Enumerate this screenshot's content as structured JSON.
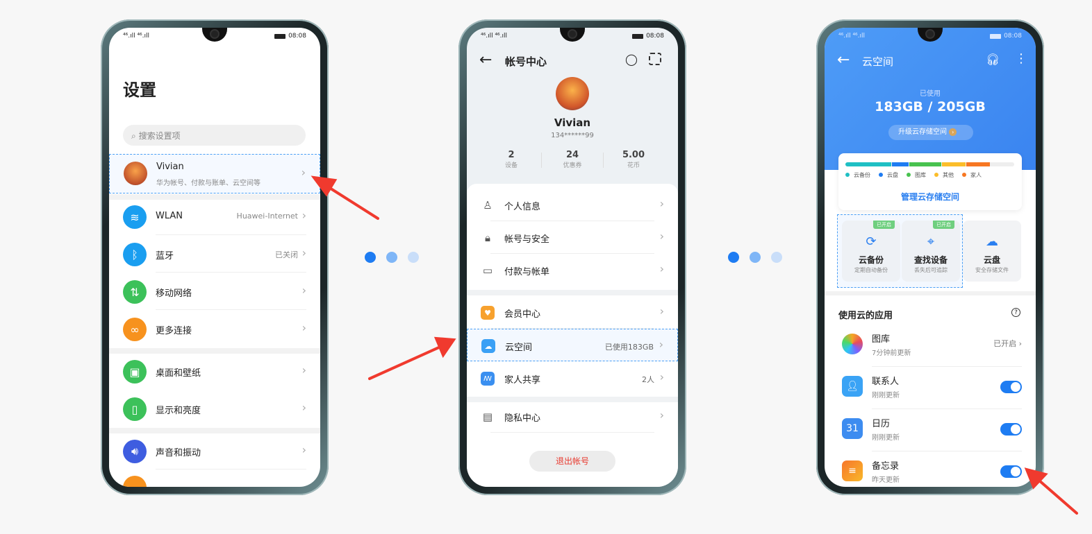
{
  "status": {
    "time": "08:08",
    "signal": "⁴⁶.ıll ⁴⁶.ıll"
  },
  "colors": {
    "accent": "#1e7cf2",
    "arrow": "#f03a2e",
    "highlight": "#4a9ff5"
  },
  "settings": {
    "title": "设置",
    "search_placeholder": "搜索设置项",
    "account": {
      "name": "Vivian",
      "subtitle": "华为帐号、付款与账单、云空间等"
    },
    "items": [
      {
        "label": "WLAN",
        "value": "Huawei-Internet",
        "icon": "wifi-icon",
        "color": "#1a9ef0"
      },
      {
        "label": "蓝牙",
        "value": "已关闭",
        "icon": "bluetooth-icon",
        "color": "#1a9ef0"
      },
      {
        "label": "移动网络",
        "value": "",
        "icon": "mobile-data-icon",
        "color": "#3cc15a"
      },
      {
        "label": "更多连接",
        "value": "",
        "icon": "link-icon",
        "color": "#f7921e"
      },
      {
        "label": "桌面和壁纸",
        "value": "",
        "icon": "wallpaper-icon",
        "color": "#3cc15a"
      },
      {
        "label": "显示和亮度",
        "value": "",
        "icon": "display-icon",
        "color": "#3cc15a"
      },
      {
        "label": "声音和振动",
        "value": "",
        "icon": "sound-icon",
        "color": "#3e5de0"
      }
    ]
  },
  "account_center": {
    "title": "帐号中心",
    "name": "Vivian",
    "phone": "134******99",
    "stats": [
      {
        "value": "2",
        "label": "设备"
      },
      {
        "value": "24",
        "label": "优惠券"
      },
      {
        "value": "5.00",
        "label": "花币"
      }
    ],
    "items": [
      {
        "label": "个人信息",
        "value": ""
      },
      {
        "label": "帐号与安全",
        "value": ""
      },
      {
        "label": "付款与帐单",
        "value": ""
      },
      {
        "label": "会员中心",
        "value": ""
      },
      {
        "label": "云空间",
        "value": "已使用183GB"
      },
      {
        "label": "家人共享",
        "value": "2人"
      },
      {
        "label": "隐私中心",
        "value": ""
      }
    ],
    "logout": "退出帐号"
  },
  "cloud": {
    "title": "云空间",
    "used_label": "已使用",
    "usage": "183GB / 205GB",
    "used_fraction": 0.89,
    "upgrade": "升级云存储空间",
    "legend": [
      {
        "label": "云备份",
        "color": "#1fbfc4",
        "share": 0.27
      },
      {
        "label": "云盘",
        "color": "#1e7cf2",
        "share": 0.1
      },
      {
        "label": "图库",
        "color": "#48c24f",
        "share": 0.19
      },
      {
        "label": "其他",
        "color": "#fbbd2a",
        "share": 0.14
      },
      {
        "label": "家人",
        "color": "#f77722",
        "share": 0.14
      }
    ],
    "manage": "管理云存储空间",
    "tiles": [
      {
        "name": "云备份",
        "sub": "定期自动备份",
        "badge": "已开启"
      },
      {
        "name": "查找设备",
        "sub": "丢失后可追踪",
        "badge": "已开启"
      },
      {
        "name": "云盘",
        "sub": "安全存储文件",
        "badge": ""
      }
    ],
    "apps_title": "使用云的应用",
    "apps": [
      {
        "name": "图库",
        "sub": "7分钟前更新",
        "value": "已开启"
      },
      {
        "name": "联系人",
        "sub": "刚刚更新",
        "on": true
      },
      {
        "name": "日历",
        "sub": "刚刚更新",
        "on": true,
        "icon_text": "31"
      },
      {
        "name": "备忘录",
        "sub": "昨天更新",
        "on": true
      }
    ]
  }
}
